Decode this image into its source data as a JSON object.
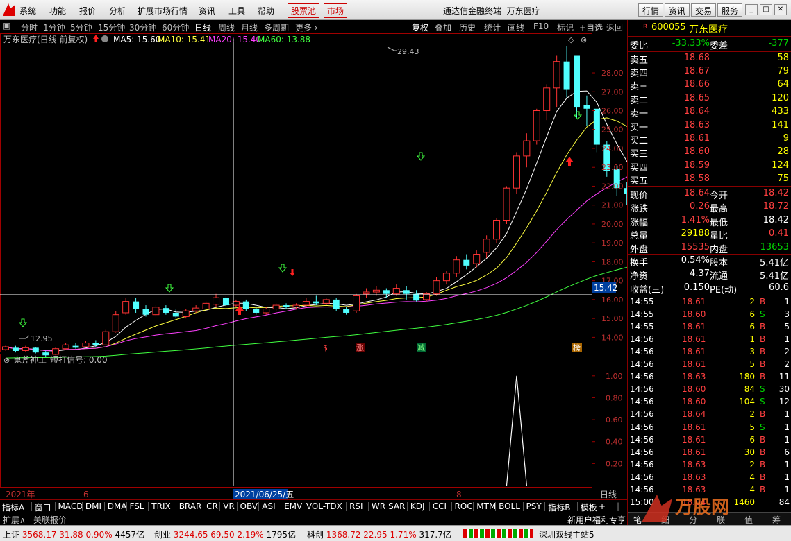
{
  "menubar": {
    "items": [
      "系统",
      "功能",
      "报价",
      "分析",
      "扩展市场行情",
      "资讯",
      "工具",
      "帮助"
    ],
    "red_items": [
      "股票池",
      "市场"
    ],
    "app_title": "通达信金融终端",
    "stock_title": "万东医疗",
    "right_buttons": [
      "行情",
      "资讯",
      "交易",
      "服务"
    ]
  },
  "periodbar": {
    "periods": [
      "分时",
      "1分钟",
      "5分钟",
      "15分钟",
      "30分钟",
      "60分钟",
      "日线",
      "周线",
      "月线",
      "多周期",
      "更多"
    ],
    "active": "日线",
    "tools": [
      "复权",
      "叠加",
      "历史",
      "统计",
      "画线",
      "F10",
      "标记",
      "+自选",
      "返回"
    ]
  },
  "main_chart": {
    "title": "万东医疗(日线 前复权)",
    "ma5_label": "MA5: 15.60",
    "ma10_label": "MA10: 15.41",
    "ma20_label": "MA20: 15.40",
    "ma60_label": "MA60: 13.88",
    "high_label": "29.43",
    "low_label": "12.95",
    "cursor_price": "15.42",
    "event_markers": [
      "$",
      "涨",
      "减",
      "榜"
    ],
    "colors": {
      "up": "#ff3333",
      "down": "#50ffff",
      "ma5": "#ffffff",
      "ma10": "#ffff40",
      "ma20": "#ff40ff",
      "ma60": "#40ff40",
      "frame": "#a00000"
    }
  },
  "indicator_chart": {
    "title": "鬼斧神工",
    "signal_label": "短打信号: 0.00"
  },
  "chart_data": [
    {
      "type": "candlestick",
      "title": "万东医疗(日线 前复权)",
      "ylim": [
        13.5,
        29.8
      ],
      "yticks": [
        14.0,
        15.0,
        16.0,
        17.0,
        18.0,
        19.0,
        20.0,
        21.0,
        22.0,
        23.0,
        24.0,
        25.0,
        26.0,
        27.0,
        28.0
      ],
      "x_labels": [
        "2021年",
        "6",
        "2021/06/25/五",
        "8",
        "日线"
      ],
      "candles": [
        [
          13.35,
          13.5,
          13.3,
          13.55
        ],
        [
          13.45,
          13.28,
          13.2,
          13.55
        ],
        [
          13.3,
          13.45,
          13.25,
          13.55
        ],
        [
          13.45,
          13.2,
          13.15,
          13.5
        ],
        [
          13.2,
          13.05,
          12.95,
          13.3
        ],
        [
          13.1,
          13.4,
          13.05,
          13.5
        ],
        [
          13.4,
          13.6,
          13.35,
          13.7
        ],
        [
          13.55,
          13.45,
          13.4,
          13.7
        ],
        [
          13.5,
          13.7,
          13.45,
          13.8
        ],
        [
          13.7,
          13.6,
          13.5,
          13.85
        ],
        [
          13.6,
          14.3,
          13.6,
          14.4
        ],
        [
          14.3,
          15.2,
          14.25,
          15.4
        ],
        [
          15.3,
          15.9,
          15.2,
          16.1
        ],
        [
          15.9,
          15.5,
          15.3,
          16.1
        ],
        [
          15.5,
          15.2,
          15.1,
          15.7
        ],
        [
          15.2,
          15.6,
          15.1,
          15.7
        ],
        [
          15.55,
          15.3,
          15.2,
          15.7
        ],
        [
          15.3,
          15.1,
          15.0,
          15.5
        ],
        [
          15.1,
          15.4,
          15.0,
          15.5
        ],
        [
          15.4,
          15.55,
          15.3,
          15.7
        ],
        [
          15.5,
          15.8,
          15.4,
          15.9
        ],
        [
          15.75,
          16.1,
          15.6,
          16.3
        ],
        [
          16.1,
          15.7,
          15.6,
          16.2
        ],
        [
          15.7,
          15.9,
          15.6,
          16.0
        ],
        [
          15.9,
          15.5,
          15.4,
          16.0
        ],
        [
          15.5,
          15.3,
          15.2,
          15.6
        ],
        [
          15.3,
          15.5,
          15.2,
          15.6
        ],
        [
          15.5,
          15.7,
          15.4,
          15.8
        ],
        [
          15.7,
          15.6,
          15.5,
          15.8
        ],
        [
          15.6,
          15.7,
          15.5,
          15.8
        ],
        [
          15.7,
          15.9,
          15.6,
          16.1
        ],
        [
          15.9,
          15.8,
          15.7,
          16.2
        ],
        [
          15.8,
          16.0,
          15.7,
          16.1
        ],
        [
          16.0,
          15.5,
          15.4,
          16.1
        ],
        [
          15.5,
          15.3,
          15.2,
          15.6
        ],
        [
          15.4,
          16.2,
          15.3,
          16.3
        ],
        [
          16.3,
          16.4,
          16.1,
          16.6
        ],
        [
          16.4,
          16.5,
          16.2,
          16.7
        ],
        [
          16.5,
          16.3,
          16.1,
          16.6
        ],
        [
          16.3,
          16.6,
          16.2,
          16.8
        ],
        [
          16.5,
          16.3,
          16.0,
          16.7
        ],
        [
          16.3,
          15.95,
          15.9,
          16.5
        ],
        [
          16.0,
          16.3,
          15.9,
          16.4
        ],
        [
          16.3,
          17.0,
          16.2,
          17.2
        ],
        [
          17.0,
          17.4,
          16.8,
          17.5
        ],
        [
          17.4,
          18.1,
          17.2,
          18.3
        ],
        [
          18.1,
          17.8,
          17.6,
          18.4
        ],
        [
          17.9,
          18.4,
          17.7,
          18.6
        ],
        [
          18.5,
          19.2,
          18.2,
          19.4
        ],
        [
          19.2,
          20.2,
          19.0,
          20.3
        ],
        [
          20.2,
          21.9,
          20.0,
          22.0
        ],
        [
          21.9,
          23.6,
          21.6,
          23.8
        ],
        [
          23.6,
          24.4,
          23.0,
          24.8
        ],
        [
          24.4,
          26.0,
          24.2,
          26.1
        ],
        [
          26.0,
          27.2,
          25.5,
          27.4
        ],
        [
          27.2,
          28.6,
          26.2,
          28.9
        ],
        [
          28.6,
          27.1,
          26.7,
          29.43
        ],
        [
          28.9,
          26.2,
          25.6,
          28.7
        ],
        [
          26.3,
          26.1,
          25.2,
          26.8
        ],
        [
          26.1,
          24.2,
          23.8,
          26.1
        ],
        [
          24.2,
          22.8,
          22.5,
          24.4
        ],
        [
          22.9,
          21.9,
          21.5,
          23.1
        ],
        [
          21.9,
          21.6,
          21.0,
          22.2
        ],
        [
          21.7,
          22.0,
          21.5,
          22.4
        ],
        [
          22.0,
          22.4,
          21.7,
          22.7
        ],
        [
          22.4,
          23.5,
          22.2,
          23.8
        ],
        [
          23.3,
          23.1,
          22.8,
          23.7
        ],
        [
          23.1,
          23.3,
          22.9,
          23.6
        ],
        [
          23.3,
          22.6,
          22.3,
          23.4
        ],
        [
          22.6,
          21.6,
          21.2,
          22.7
        ],
        [
          21.6,
          21.5,
          20.7,
          21.8
        ],
        [
          21.5,
          21.7,
          21.4,
          21.9
        ],
        [
          21.7,
          21.9,
          21.6,
          22.1
        ],
        [
          21.9,
          22.0,
          21.7,
          22.2
        ],
        [
          22.0,
          21.7,
          21.5,
          22.2
        ],
        [
          21.6,
          21.5,
          21.4,
          21.8
        ],
        [
          21.5,
          21.5,
          21.2,
          21.9
        ],
        [
          21.5,
          22.4,
          21.4,
          22.6
        ],
        [
          22.4,
          23.6,
          22.3,
          25.4
        ],
        [
          23.6,
          24.2,
          23.4,
          24.6
        ],
        [
          24.2,
          24.0,
          23.7,
          25.5
        ],
        [
          23.8,
          24.9,
          23.2,
          25.2
        ],
        [
          24.9,
          22.4,
          22.3,
          25.0
        ],
        [
          22.2,
          21.8,
          21.0,
          22.3
        ]
      ],
      "series": [
        {
          "name": "MA5",
          "value_label": "15.60"
        },
        {
          "name": "MA10",
          "value_label": "15.41"
        },
        {
          "name": "MA20",
          "value_label": "15.40"
        },
        {
          "name": "MA60",
          "value_label": "13.88"
        }
      ]
    },
    {
      "type": "line",
      "title": "鬼斧神工",
      "ylim": [
        0,
        1.1
      ],
      "yticks": [
        0.2,
        0.4,
        0.6,
        0.8,
        1.0
      ],
      "spike_index": 51,
      "spike_value": 1.0
    }
  ],
  "indicator_tabs": [
    "指标A",
    "窗口",
    "MACD",
    "DMI",
    "DMA",
    "FSL",
    "TRIX",
    "BRAR",
    "CR",
    "VR",
    "OBV",
    "ASI",
    "EMV",
    "VOL-TDX",
    "RSI",
    "WR",
    "SAR",
    "KDJ",
    "CCI",
    "ROC",
    "MTM",
    "BOLL",
    "PSY",
    "指标B",
    "模板"
  ],
  "indicator_extra": [
    "+",
    "|"
  ],
  "ext_tabs": [
    "扩展∧",
    "关联报价"
  ],
  "promo": "新用户福利专享",
  "quote": {
    "badge": "R",
    "code": "600055",
    "name": "万东医疗",
    "weibi_label": "委比",
    "weibi": "-33.33%",
    "weicha_label": "委差",
    "weicha": "-377",
    "asks": [
      {
        "label": "卖五",
        "price": "18.68",
        "vol": "58"
      },
      {
        "label": "卖四",
        "price": "18.67",
        "vol": "79"
      },
      {
        "label": "卖三",
        "price": "18.66",
        "vol": "64"
      },
      {
        "label": "卖二",
        "price": "18.65",
        "vol": "120"
      },
      {
        "label": "卖一",
        "price": "18.64",
        "vol": "433"
      }
    ],
    "bids": [
      {
        "label": "买一",
        "price": "18.63",
        "vol": "141"
      },
      {
        "label": "买二",
        "price": "18.61",
        "vol": "9"
      },
      {
        "label": "买三",
        "price": "18.60",
        "vol": "28"
      },
      {
        "label": "买四",
        "price": "18.59",
        "vol": "124"
      },
      {
        "label": "买五",
        "price": "18.58",
        "vol": "75"
      }
    ],
    "stats": [
      {
        "l1": "现价",
        "v1": "18.64",
        "l2": "今开",
        "v2": "18.42"
      },
      {
        "l1": "涨跌",
        "v1": "0.26",
        "l2": "最高",
        "v2": "18.72"
      },
      {
        "l1": "涨幅",
        "v1": "1.41%",
        "l2": "最低",
        "v2": "18.42"
      },
      {
        "l1": "总量",
        "v1": "29188",
        "l2": "量比",
        "v2": "0.41"
      },
      {
        "l1": "外盘",
        "v1": "15535",
        "l2": "内盘",
        "v2": "13653"
      }
    ],
    "stats2": [
      {
        "l1": "换手",
        "v1": "0.54%",
        "l2": "股本",
        "v2": "5.41亿"
      },
      {
        "l1": "净资",
        "v1": "4.37",
        "l2": "流通",
        "v2": "5.41亿"
      },
      {
        "l1": "收益(三)",
        "v1": "0.150",
        "l2": "PE(动)",
        "v2": "60.6"
      }
    ]
  },
  "ticks": [
    {
      "t": "14:55",
      "p": "18.61",
      "v": "2",
      "d": "B",
      "n": "1"
    },
    {
      "t": "14:55",
      "p": "18.60",
      "v": "6",
      "d": "S",
      "n": "3"
    },
    {
      "t": "14:55",
      "p": "18.61",
      "v": "6",
      "d": "B",
      "n": "5"
    },
    {
      "t": "14:56",
      "p": "18.61",
      "v": "1",
      "d": "B",
      "n": "1"
    },
    {
      "t": "14:56",
      "p": "18.61",
      "v": "3",
      "d": "B",
      "n": "2"
    },
    {
      "t": "14:56",
      "p": "18.61",
      "v": "5",
      "d": "B",
      "n": "2"
    },
    {
      "t": "14:56",
      "p": "18.63",
      "v": "180",
      "d": "B",
      "n": "11"
    },
    {
      "t": "14:56",
      "p": "18.60",
      "v": "84",
      "d": "S",
      "n": "30"
    },
    {
      "t": "14:56",
      "p": "18.60",
      "v": "104",
      "d": "S",
      "n": "12"
    },
    {
      "t": "14:56",
      "p": "18.64",
      "v": "2",
      "d": "B",
      "n": "1"
    },
    {
      "t": "14:56",
      "p": "18.61",
      "v": "5",
      "d": "S",
      "n": "1"
    },
    {
      "t": "14:56",
      "p": "18.61",
      "v": "6",
      "d": "B",
      "n": "1"
    },
    {
      "t": "14:56",
      "p": "18.61",
      "v": "30",
      "d": "B",
      "n": "6"
    },
    {
      "t": "14:56",
      "p": "18.63",
      "v": "2",
      "d": "B",
      "n": "1"
    },
    {
      "t": "14:56",
      "p": "18.63",
      "v": "4",
      "d": "B",
      "n": "1"
    },
    {
      "t": "14:56",
      "p": "18.63",
      "v": "4",
      "d": "B",
      "n": "1"
    },
    {
      "t": "15:00",
      "p": "18.64",
      "v": "1460",
      "d": "",
      "n": "84"
    }
  ],
  "rbottom_tabs": [
    "笔",
    "细",
    "分",
    "联",
    "值",
    "筹"
  ],
  "status": {
    "items": [
      {
        "name": "上证",
        "val": "3568.17",
        "chg": "31.88",
        "pct": "0.90%",
        "amt": "4457亿"
      },
      {
        "name": "创业",
        "val": "3244.65",
        "chg": "69.50",
        "pct": "2.19%",
        "amt": "1795亿"
      },
      {
        "name": "科创",
        "val": "1368.72",
        "chg": "22.95",
        "pct": "1.71%",
        "amt": "317.7亿"
      }
    ],
    "server": "深圳双线主站5",
    "watermark": "万股网"
  }
}
